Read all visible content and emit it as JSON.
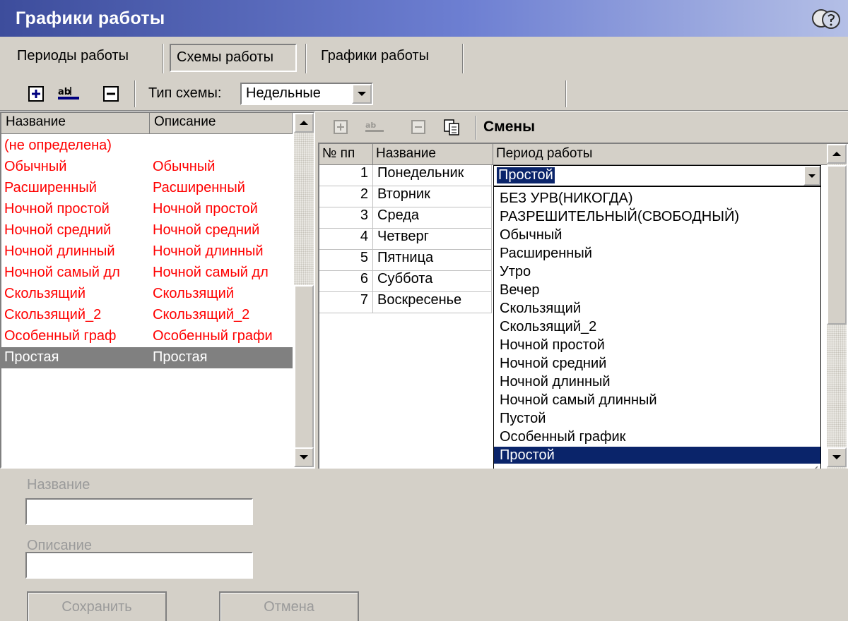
{
  "window": {
    "title": "Графики работы"
  },
  "tabs": [
    {
      "label": "Периоды работы"
    },
    {
      "label": "Схемы работы"
    },
    {
      "label": "Графики работы"
    }
  ],
  "toolbar": {
    "scheme_type_label": "Тип схемы:",
    "scheme_type_value": "Недельные"
  },
  "schemes_list": {
    "columns": [
      "Название",
      "Описание"
    ],
    "rows": [
      {
        "name": "(не определена)",
        "description": ""
      },
      {
        "name": "Обычный",
        "description": "Обычный"
      },
      {
        "name": "Расширенный",
        "description": "Расширенный"
      },
      {
        "name": "Ночной простой",
        "description": "Ночной простой"
      },
      {
        "name": "Ночной средний",
        "description": "Ночной средний"
      },
      {
        "name": "Ночной длинный",
        "description": "Ночной длинный"
      },
      {
        "name": "Ночной самый дл",
        "description": "Ночной самый дл"
      },
      {
        "name": "Скользящий",
        "description": "Скользящий"
      },
      {
        "name": "Скользящий_2",
        "description": "Скользящий_2"
      },
      {
        "name": "Особенный граф",
        "description": "Особенный графи"
      },
      {
        "name": "Простая",
        "description": "Простая"
      }
    ],
    "selected_index": 10
  },
  "shifts": {
    "title": "Смены",
    "columns": [
      "№ пп",
      "Название",
      "Период работы"
    ],
    "rows": [
      {
        "num": "1",
        "name": "Понедельник"
      },
      {
        "num": "2",
        "name": "Вторник"
      },
      {
        "num": "3",
        "name": "Среда"
      },
      {
        "num": "4",
        "name": "Четверг"
      },
      {
        "num": "5",
        "name": "Пятница"
      },
      {
        "num": "6",
        "name": "Суббота"
      },
      {
        "num": "7",
        "name": "Воскресенье"
      }
    ],
    "editing_value": "Простой",
    "period_options": [
      "БЕЗ УРВ(НИКОГДА)",
      "РАЗРЕШИТЕЛЬНЫЙ(СВОБОДНЫЙ)",
      "Обычный",
      "Расширенный",
      "Утро",
      "Вечер",
      "Скользящий",
      "Скользящий_2",
      "Ночной простой",
      "Ночной средний",
      "Ночной длинный",
      "Ночной самый длинный",
      "Пустой",
      "Особенный график",
      "Простой"
    ],
    "selected_option_index": 14
  },
  "form": {
    "name_label": "Название",
    "name_value": "",
    "description_label": "Описание",
    "description_value": "",
    "save_label": "Сохранить",
    "cancel_label": "Отмена"
  },
  "colors": {
    "title_gradient_start": "#3d4d9c",
    "row_text_red": "#ff0000",
    "selection_blue": "#0a246a",
    "selection_gray": "#808080",
    "panel_gray": "#d4d0c8"
  }
}
